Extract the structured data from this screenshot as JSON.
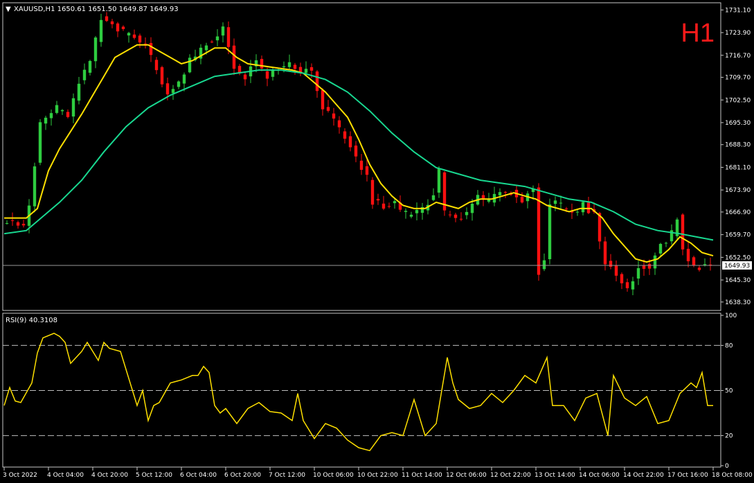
{
  "header": {
    "marker": "▼",
    "text": "XAUUSD,H1  1650.61 1651.50 1649.87 1649.93"
  },
  "timeframe_label": "H1",
  "rsi_header": "RSI(9) 40.3108",
  "current_price": "1649.93",
  "colors": {
    "background": "#000000",
    "frame": "#c8c8c8",
    "bull": "#2ecc40",
    "bear": "#ff1010",
    "ma_fast": "#ffe000",
    "ma_slow": "#18d890",
    "rsi": "#ffe000",
    "timeframe": "#ff1a1a"
  },
  "chart_data": [
    {
      "type": "candlestick",
      "symbol": "XAUUSD",
      "timeframe": "H1",
      "ohlc_last": {
        "open": 1650.61,
        "high": 1651.5,
        "low": 1649.87,
        "close": 1649.93
      },
      "ylim": [
        1636.5,
        1732.5
      ],
      "y_ticks": [
        "1731.10",
        "1723.90",
        "1716.70",
        "1709.70",
        "1702.50",
        "1695.30",
        "1688.30",
        "1681.10",
        "1673.90",
        "1666.90",
        "1659.70",
        "1652.50",
        "1645.30",
        "1638.30"
      ],
      "x_ticks": [
        "3 Oct 2022",
        "4 Oct 04:00",
        "4 Oct 20:00",
        "5 Oct 12:00",
        "6 Oct 04:00",
        "6 Oct 20:00",
        "7 Oct 12:00",
        "10 Oct 06:00",
        "10 Oct 22:00",
        "11 Oct 14:00",
        "12 Oct 06:00",
        "12 Oct 22:00",
        "13 Oct 14:00",
        "14 Oct 06:00",
        "14 Oct 22:00",
        "17 Oct 16:00",
        "18 Oct 08:00"
      ],
      "close_path": [
        [
          0,
          1664
        ],
        [
          4,
          1663
        ],
        [
          5,
          1668
        ],
        [
          6,
          1682
        ],
        [
          7,
          1695
        ],
        [
          10,
          1700
        ],
        [
          12,
          1697
        ],
        [
          14,
          1708
        ],
        [
          16,
          1715
        ],
        [
          18,
          1728
        ],
        [
          20,
          1726
        ],
        [
          22,
          1724
        ],
        [
          26,
          1720
        ],
        [
          28,
          1712
        ],
        [
          30,
          1705
        ],
        [
          32,
          1708
        ],
        [
          34,
          1715
        ],
        [
          36,
          1718
        ],
        [
          38,
          1722
        ],
        [
          40,
          1725
        ],
        [
          42,
          1713
        ],
        [
          44,
          1710
        ],
        [
          46,
          1715
        ],
        [
          48,
          1710
        ],
        [
          50,
          1712
        ],
        [
          52,
          1714
        ],
        [
          54,
          1712
        ],
        [
          56,
          1712
        ],
        [
          58,
          1700
        ],
        [
          60,
          1696
        ],
        [
          62,
          1690
        ],
        [
          64,
          1684
        ],
        [
          66,
          1678
        ],
        [
          67,
          1670
        ],
        [
          69,
          1669
        ],
        [
          71,
          1670
        ],
        [
          72,
          1667
        ],
        [
          74,
          1666
        ],
        [
          76,
          1668
        ],
        [
          78,
          1672
        ],
        [
          79,
          1680
        ],
        [
          80,
          1667
        ],
        [
          82,
          1665
        ],
        [
          84,
          1666
        ],
        [
          86,
          1672
        ],
        [
          88,
          1670
        ],
        [
          90,
          1674
        ],
        [
          92,
          1673
        ],
        [
          94,
          1670
        ],
        [
          96,
          1675
        ],
        [
          97,
          1648
        ],
        [
          98,
          1652
        ],
        [
          99,
          1670
        ],
        [
          101,
          1669
        ],
        [
          103,
          1666
        ],
        [
          105,
          1669
        ],
        [
          107,
          1666
        ],
        [
          109,
          1651
        ],
        [
          111,
          1647
        ],
        [
          113,
          1642
        ],
        [
          115,
          1649
        ],
        [
          117,
          1650
        ],
        [
          119,
          1656
        ],
        [
          121,
          1660
        ],
        [
          122,
          1665
        ],
        [
          123,
          1655
        ],
        [
          125,
          1649
        ],
        [
          127,
          1650
        ]
      ],
      "series": [
        {
          "name": "",
          "values": [
            [
              0,
              1665
            ],
            [
              4,
              1665
            ],
            [
              6,
              1668
            ],
            [
              8,
              1680
            ],
            [
              10,
              1687
            ],
            [
              14,
              1698
            ],
            [
              18,
              1710
            ],
            [
              20,
              1716
            ],
            [
              24,
              1720
            ],
            [
              26,
              1720
            ],
            [
              28,
              1718
            ],
            [
              30,
              1716
            ],
            [
              32,
              1714
            ],
            [
              34,
              1715
            ],
            [
              36,
              1717
            ],
            [
              38,
              1719
            ],
            [
              40,
              1719
            ],
            [
              42,
              1716
            ],
            [
              44,
              1714
            ],
            [
              48,
              1713
            ],
            [
              52,
              1712
            ],
            [
              54,
              1711
            ],
            [
              58,
              1705
            ],
            [
              60,
              1701
            ],
            [
              62,
              1697
            ],
            [
              64,
              1690
            ],
            [
              66,
              1682
            ],
            [
              68,
              1676
            ],
            [
              70,
              1672
            ],
            [
              72,
              1669
            ],
            [
              74,
              1668
            ],
            [
              76,
              1668
            ],
            [
              78,
              1670
            ],
            [
              80,
              1669
            ],
            [
              82,
              1668
            ],
            [
              84,
              1670
            ],
            [
              86,
              1671
            ],
            [
              88,
              1671
            ],
            [
              90,
              1672
            ],
            [
              92,
              1673
            ],
            [
              94,
              1672
            ],
            [
              96,
              1671
            ],
            [
              98,
              1669
            ],
            [
              100,
              1668
            ],
            [
              102,
              1667
            ],
            [
              104,
              1668
            ],
            [
              106,
              1668
            ],
            [
              108,
              1665
            ],
            [
              110,
              1660
            ],
            [
              112,
              1656
            ],
            [
              114,
              1652
            ],
            [
              116,
              1651
            ],
            [
              118,
              1652
            ],
            [
              120,
              1655
            ],
            [
              122,
              1659
            ],
            [
              124,
              1657
            ],
            [
              126,
              1654
            ],
            [
              128,
              1653
            ]
          ]
        },
        {
          "name": "",
          "values": [
            [
              0,
              1660
            ],
            [
              4,
              1661
            ],
            [
              6,
              1664
            ],
            [
              10,
              1670
            ],
            [
              14,
              1677
            ],
            [
              18,
              1686
            ],
            [
              22,
              1694
            ],
            [
              26,
              1700
            ],
            [
              30,
              1704
            ],
            [
              34,
              1707
            ],
            [
              38,
              1710
            ],
            [
              42,
              1711
            ],
            [
              46,
              1712
            ],
            [
              50,
              1712
            ],
            [
              54,
              1711
            ],
            [
              58,
              1709
            ],
            [
              62,
              1705
            ],
            [
              66,
              1699
            ],
            [
              70,
              1692
            ],
            [
              74,
              1686
            ],
            [
              78,
              1681
            ],
            [
              82,
              1679
            ],
            [
              86,
              1677
            ],
            [
              90,
              1676
            ],
            [
              94,
              1675
            ],
            [
              98,
              1673
            ],
            [
              102,
              1671
            ],
            [
              106,
              1670
            ],
            [
              110,
              1667
            ],
            [
              114,
              1663
            ],
            [
              118,
              1661
            ],
            [
              122,
              1660
            ],
            [
              128,
              1658
            ]
          ]
        }
      ]
    },
    {
      "type": "line",
      "title": "RSI(9) 40.3108",
      "ylim": [
        0,
        100
      ],
      "y_ticks": [
        "100",
        "80",
        "50",
        "20",
        "0"
      ],
      "levels": [
        80,
        50,
        20
      ],
      "series": [
        {
          "name": "RSI(9)",
          "values": [
            [
              0,
              40
            ],
            [
              1,
              52
            ],
            [
              2,
              43
            ],
            [
              3,
              42
            ],
            [
              5,
              55
            ],
            [
              6,
              75
            ],
            [
              7,
              85
            ],
            [
              9,
              88
            ],
            [
              10,
              86
            ],
            [
              11,
              82
            ],
            [
              12,
              68
            ],
            [
              14,
              76
            ],
            [
              15,
              82
            ],
            [
              17,
              70
            ],
            [
              18,
              82
            ],
            [
              19,
              78
            ],
            [
              21,
              76
            ],
            [
              22,
              64
            ],
            [
              24,
              40
            ],
            [
              25,
              50
            ],
            [
              26,
              30
            ],
            [
              27,
              40
            ],
            [
              28,
              42
            ],
            [
              30,
              55
            ],
            [
              32,
              57
            ],
            [
              34,
              60
            ],
            [
              35,
              60
            ],
            [
              36,
              66
            ],
            [
              37,
              62
            ],
            [
              38,
              40
            ],
            [
              39,
              35
            ],
            [
              40,
              38
            ],
            [
              42,
              28
            ],
            [
              44,
              38
            ],
            [
              46,
              42
            ],
            [
              48,
              36
            ],
            [
              50,
              35
            ],
            [
              52,
              30
            ],
            [
              53,
              48
            ],
            [
              54,
              30
            ],
            [
              56,
              18
            ],
            [
              58,
              28
            ],
            [
              60,
              25
            ],
            [
              62,
              17
            ],
            [
              64,
              12
            ],
            [
              66,
              10
            ],
            [
              68,
              20
            ],
            [
              70,
              22
            ],
            [
              72,
              20
            ],
            [
              74,
              44
            ],
            [
              76,
              20
            ],
            [
              78,
              28
            ],
            [
              79,
              50
            ],
            [
              80,
              72
            ],
            [
              81,
              55
            ],
            [
              82,
              44
            ],
            [
              84,
              38
            ],
            [
              86,
              40
            ],
            [
              88,
              48
            ],
            [
              90,
              42
            ],
            [
              92,
              50
            ],
            [
              94,
              60
            ],
            [
              96,
              55
            ],
            [
              98,
              72
            ],
            [
              99,
              40
            ],
            [
              101,
              40
            ],
            [
              103,
              30
            ],
            [
              105,
              45
            ],
            [
              107,
              48
            ],
            [
              109,
              20
            ],
            [
              110,
              60
            ],
            [
              112,
              45
            ],
            [
              114,
              40
            ],
            [
              116,
              46
            ],
            [
              118,
              28
            ],
            [
              120,
              30
            ],
            [
              122,
              48
            ],
            [
              124,
              55
            ],
            [
              125,
              52
            ],
            [
              126,
              62
            ],
            [
              127,
              40
            ],
            [
              128,
              40
            ]
          ]
        }
      ]
    }
  ]
}
